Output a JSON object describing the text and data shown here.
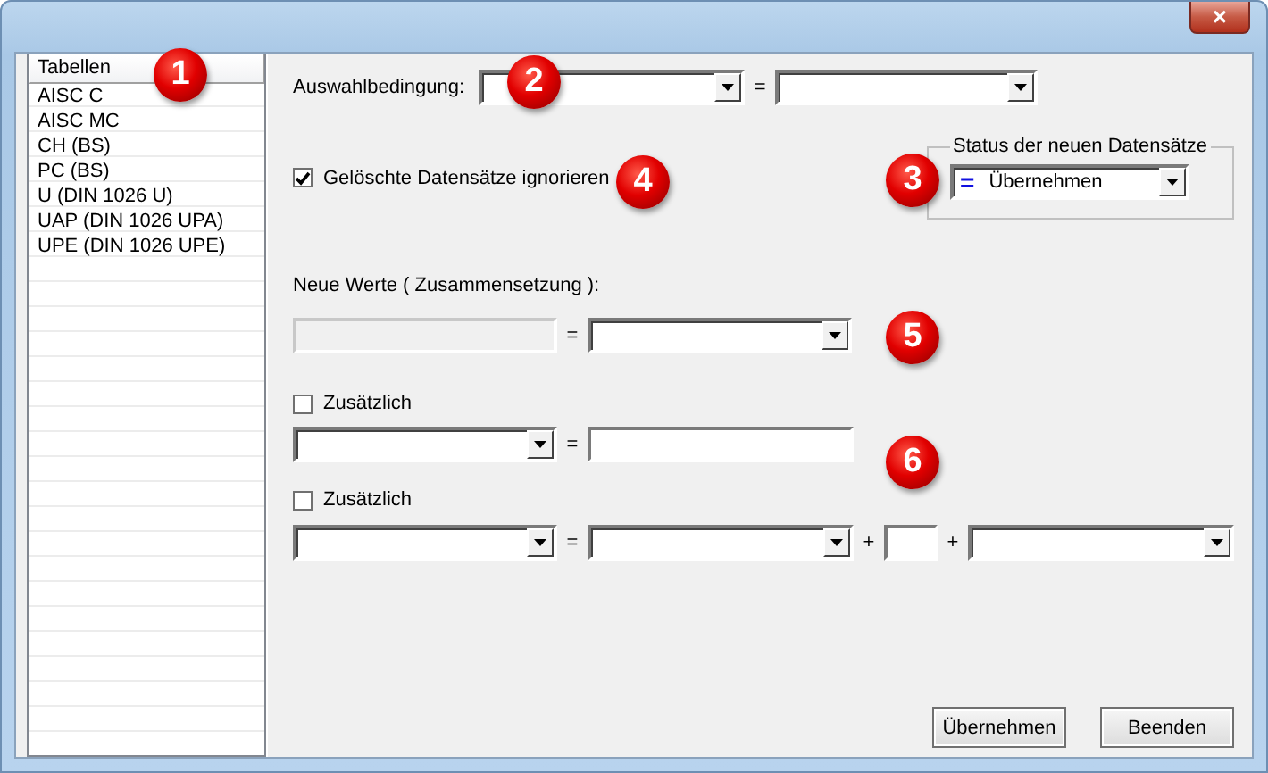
{
  "window": {
    "close_button": "×"
  },
  "table_list": {
    "header": "Tabellen",
    "items": [
      {
        "label": "AISC C",
        "selected": false
      },
      {
        "label": "AISC MC",
        "selected": false
      },
      {
        "label": "CH (BS)",
        "selected": false
      },
      {
        "label": "PC (BS)",
        "selected": false
      },
      {
        "label": "U (DIN 1026 U)",
        "selected": false
      },
      {
        "label": "UAP (DIN 1026 UPA)",
        "selected": false
      },
      {
        "label": "UPE (DIN 1026 UPE)",
        "selected": false
      }
    ]
  },
  "selection": {
    "label": "Auswahlbedingung:",
    "operator": "="
  },
  "ignore_deleted": {
    "label": "Gelöschte Datensätze ignorieren",
    "checked": true
  },
  "status_group": {
    "title": "Status der neuen Datensätze",
    "status_mark": "=",
    "value": "Übernehmen"
  },
  "new_values": {
    "label": "Neue Werte ( Zusammensetzung ):",
    "operator": "="
  },
  "additional": [
    {
      "label": "Zusätzlich",
      "checked": false,
      "kind": "simple",
      "operators": [
        "="
      ]
    },
    {
      "label": "Zusätzlich",
      "checked": false,
      "kind": "compound",
      "operators": [
        "=",
        "+",
        "+"
      ]
    }
  ],
  "buttons": [
    "Übernehmen",
    "Beenden"
  ],
  "callouts": [
    "1",
    "2",
    "3",
    "4",
    "5",
    "6"
  ]
}
